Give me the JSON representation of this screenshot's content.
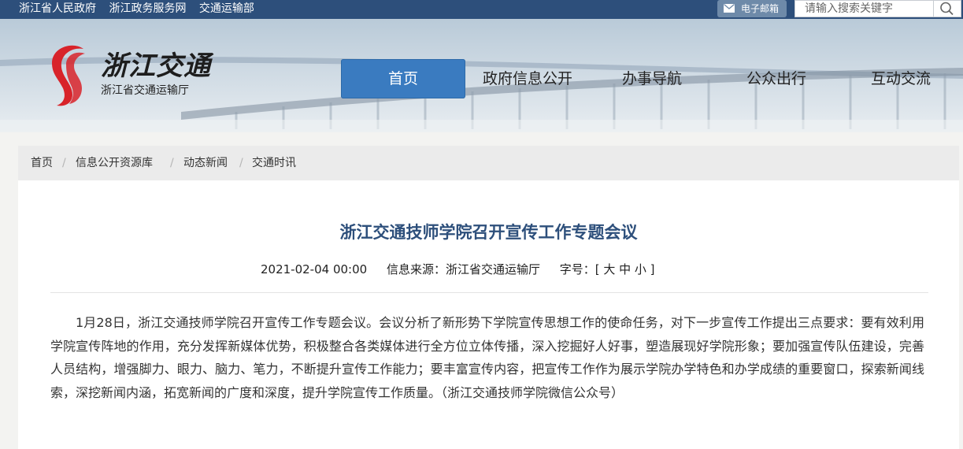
{
  "topbar": {
    "links": [
      "浙江省人民政府",
      "浙江政务服务网",
      "交通运输部"
    ],
    "mail_label": "电子邮箱",
    "search_placeholder": "请输入搜索关键字"
  },
  "logo": {
    "script_text": "浙江交通",
    "subtitle": "浙江省交通运输厅"
  },
  "nav": [
    "首页",
    "政府信息公开",
    "办事导航",
    "公众出行",
    "互动交流"
  ],
  "breadcrumb": [
    "首页",
    "信息公开资源库",
    "动态新闻",
    "交通时讯"
  ],
  "article": {
    "title": "浙江交通技师学院召开宣传工作专题会议",
    "date": "2021-02-04 00:00",
    "source": "信息来源：浙江省交通运输厅",
    "font_size_label": "字号：[ 大 中 小 ]",
    "body": "1月28日，浙江交通技师学院召开宣传工作专题会议。会议分析了新形势下学院宣传思想工作的使命任务，对下一步宣传工作提出三点要求：要有效利用学院宣传阵地的作用，充分发挥新媒体优势，积极整合各类媒体进行全方位立体传播，深入挖掘好人好事，塑造展现好学院形象；要加强宣传队伍建设，完善人员结构，增强脚力、眼力、脑力、笔力，不断提升宣传工作能力；要丰富宣传内容，把宣传工作作为展示学院办学特色和办学成绩的重要窗口，探索新闻线索，深挖新闻内涵，拓宽新闻的广度和深度，提升学院宣传工作质量。（浙江交通技师学院微信公众号）"
  },
  "colors": {
    "topbar": "#2d4f7b",
    "nav_active": "#3a7bc0",
    "title": "#2d4f7b",
    "logo_red": "#d8232a"
  }
}
